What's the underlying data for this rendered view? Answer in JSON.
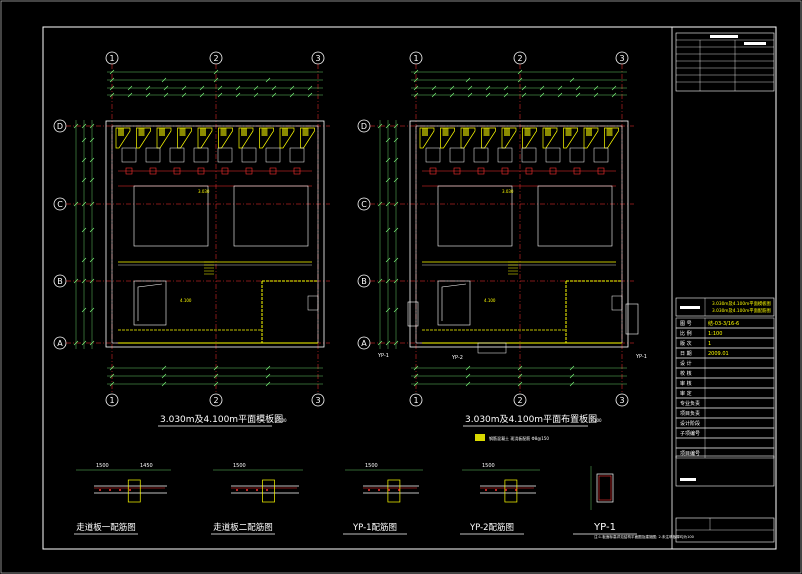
{
  "axes": {
    "columns": [
      "1",
      "2",
      "3"
    ],
    "rows": [
      "D",
      "C",
      "B",
      "A"
    ]
  },
  "plans": [
    {
      "title": "3.030m及4.100m平面模板图",
      "scale": "1:100",
      "labels": {
        "h1": "3.030",
        "h2": "4.100"
      }
    },
    {
      "title": "3.030m及4.100m平面布置板图",
      "scale": "1:100",
      "labels": {
        "h1": "3.030",
        "h2": "4.100"
      },
      "callouts": {
        "a": "YP-1",
        "b": "YP-2",
        "c": "YP-1",
        "d": "YP-2"
      }
    }
  ],
  "legend": {
    "text": "钢筋混凝土 现浇板配筋 Φ8@150"
  },
  "details": [
    {
      "title": "走道板一配筋图",
      "dims": [
        "1500",
        "1450"
      ]
    },
    {
      "title": "走道板二配筋图",
      "dims": [
        "1500"
      ]
    },
    {
      "title": "YP-1配筋图",
      "dims": [
        "1500"
      ]
    },
    {
      "title": "YP-2配筋图",
      "dims": [
        "1500"
      ]
    },
    {
      "title": "YP-1",
      "dims": []
    }
  ],
  "note": "注:1.板面标高详见结构平面图及建施图; 2.未注明板厚均为100",
  "title_block": {
    "drawing_name_1": "3.030m及4.100m平面模板图",
    "drawing_name_2": "3.030m及4.100m平面配筋图",
    "rows": [
      {
        "label": "图 号",
        "value": "结-03-3/16-6"
      },
      {
        "label": "比 例",
        "value": "1:100"
      },
      {
        "label": "版 次",
        "value": "1"
      },
      {
        "label": "日 期",
        "value": "2009.01"
      },
      {
        "label": "设 计",
        "value": ""
      },
      {
        "label": "校 核",
        "value": ""
      },
      {
        "label": "审 核",
        "value": ""
      },
      {
        "label": "审 定",
        "value": ""
      },
      {
        "label": "专业负责",
        "value": ""
      },
      {
        "label": "项目负责",
        "value": ""
      },
      {
        "label": "设计阶段",
        "value": ""
      },
      {
        "label": "子项编号",
        "value": ""
      },
      {
        "label": "",
        "value": ""
      },
      {
        "label": "项目编号",
        "value": ""
      }
    ]
  }
}
